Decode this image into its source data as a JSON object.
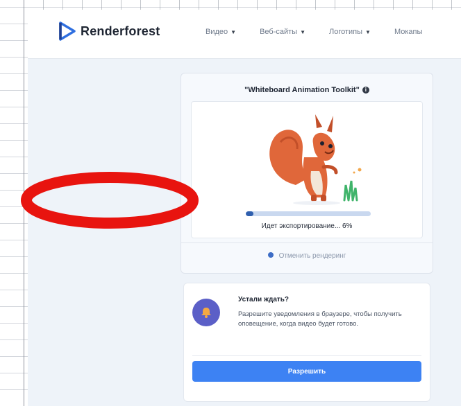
{
  "header": {
    "logo_text": "Renderforest",
    "nav": [
      {
        "label": "Видео"
      },
      {
        "label": "Веб-сайты"
      },
      {
        "label": "Логотипы"
      },
      {
        "label": "Мокапы"
      }
    ]
  },
  "render": {
    "title": "\"Whiteboard Animation Toolkit\"",
    "progress_label": "Идет экспортирование... 6%",
    "progress_fraction": 0.06,
    "cancel_label": "Отменить рендеринг"
  },
  "notify": {
    "title": "Устали ждать?",
    "text": "Разрешите уведомления в браузере, чтобы получить оповещение, когда видео будет готово.",
    "allow_label": "Разрешить"
  },
  "colors": {
    "brand_blue": "#3d82f3",
    "progress_fill": "#2f5fae",
    "annotation_red": "#e8140f"
  }
}
